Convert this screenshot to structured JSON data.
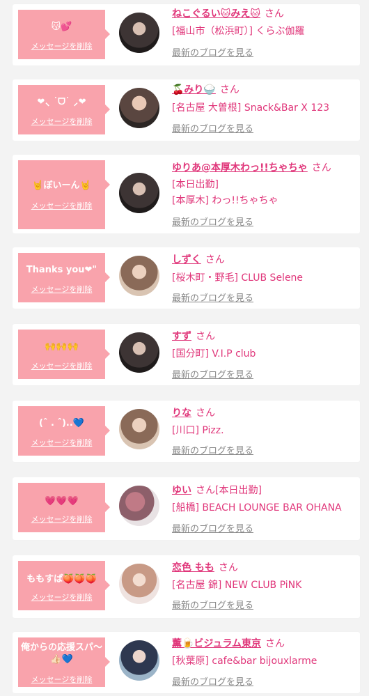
{
  "delete_label": "メッセージを削除",
  "blog_label": "最新のブログを見る",
  "san_label": "さん",
  "cards": [
    {
      "message": "😽💕",
      "name": "ねこぐるい🐱みえ🐱",
      "status": "",
      "info": "[福山市（松浜町）] くらぶ伽羅"
    },
    {
      "message": "❤⸜ ˙ᗜ˙ ⸝❤",
      "name": "🍒みり🍚",
      "status": "",
      "info": "[名古屋 大曽根] Snack&Bar X 123"
    },
    {
      "message": "🤘ぼいーん🤘",
      "name": "ゆりあ@本厚木わっ!!ちゃちゃ",
      "status": "[本日出勤]",
      "info": "[本厚木] わっ!!ちゃちゃ"
    },
    {
      "message": "Thanks you❤\"",
      "name": "しずく",
      "status": "",
      "info": "[桜木町・野毛] CLUB Selene"
    },
    {
      "message": "🙌🙌🙌",
      "name": "すず",
      "status": "",
      "info": "[国分町] V.I.P club"
    },
    {
      "message": "(ˆ . ˆ)..💙",
      "name": "りな",
      "status": "",
      "info": "[川口] Pizz."
    },
    {
      "message": "💗💗💗",
      "name": "ゆい",
      "status": "[本日出勤]",
      "info": "[船橋] BEACH LOUNGE BAR OHANA"
    },
    {
      "message": "ももすぱ🍑🍑🍑",
      "name": "恋色 もも",
      "status": "",
      "info": "[名古屋 錦] NEW CLUB PiNK"
    },
    {
      "message": "俺からの応援スパ〜👍🏻💙",
      "name": "薫🍺ビジュラム東京",
      "status": "",
      "info": "[秋葉原] cafe&bar bijouxlarme"
    }
  ]
}
